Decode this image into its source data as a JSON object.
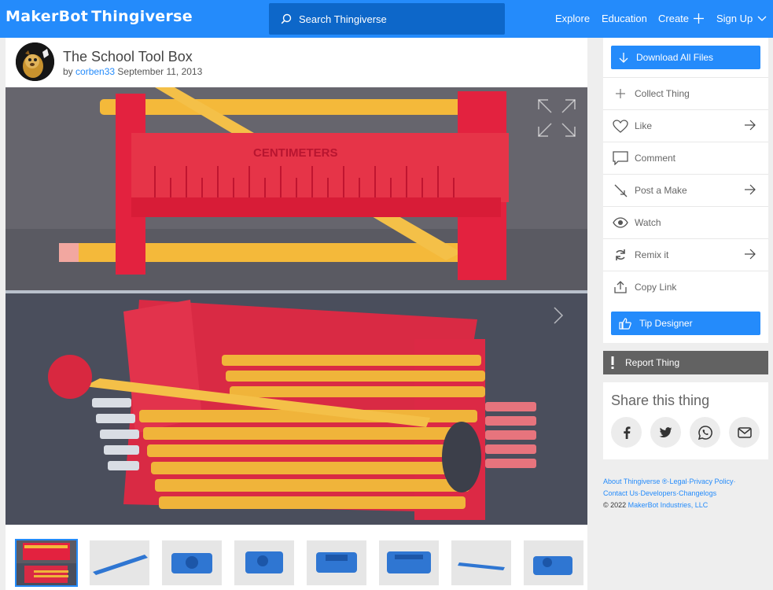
{
  "header": {
    "logo_makerbot": "MakerBot",
    "logo_thingiverse": "Thingiverse",
    "search_placeholder": "Search Thingiverse",
    "nav": {
      "explore": "Explore",
      "education": "Education",
      "create": "Create",
      "signup": "Sign Up"
    },
    "color": "#248bfb"
  },
  "thing": {
    "title": "The School Tool Box",
    "by": "by",
    "author": "corben33",
    "date": "September 11, 2013"
  },
  "image_text": {
    "centimeters": "CENTIMETERS"
  },
  "gallery": {
    "thumbnails": [
      "photo",
      "ruler",
      "box-part",
      "box-part",
      "box-part",
      "box-part",
      "ruler",
      "box-part"
    ]
  },
  "sidebar": {
    "download_label": "Download All Files",
    "actions": [
      {
        "label": "Collect Thing",
        "icon": "plus-icon",
        "arrow": false
      },
      {
        "label": "Like",
        "icon": "heart-icon",
        "arrow": true
      },
      {
        "label": "Comment",
        "icon": "comment-icon",
        "arrow": false
      },
      {
        "label": "Post a Make",
        "icon": "make-icon",
        "arrow": true
      },
      {
        "label": "Watch",
        "icon": "eye-icon",
        "arrow": false
      },
      {
        "label": "Remix it",
        "icon": "remix-icon",
        "arrow": true
      },
      {
        "label": "Copy Link",
        "icon": "share-link-icon",
        "arrow": false
      }
    ],
    "tip_label": "Tip Designer",
    "report_label": "Report Thing",
    "share_title": "Share this thing"
  },
  "footer": {
    "line1": "About Thingiverse ®·Legal·Privacy Policy·",
    "line2": "Contact Us·Developers·Changelogs",
    "copyright_prefix": "©  2022 ",
    "copyright_link": "MakerBot Industries, LLC"
  }
}
